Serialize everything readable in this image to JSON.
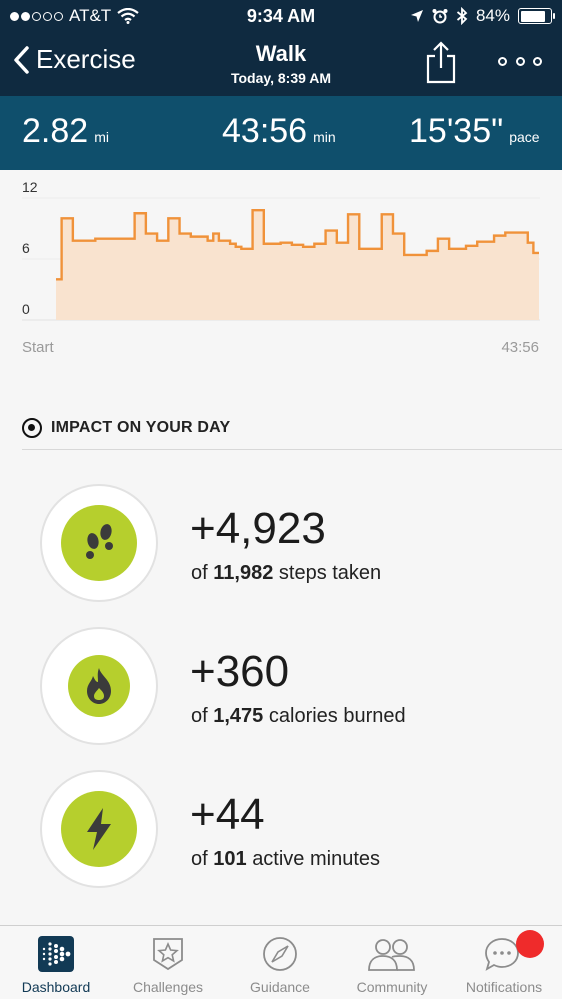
{
  "status_bar": {
    "carrier": "AT&T",
    "time": "9:34 AM",
    "battery": "84%",
    "battery_level": 0.84
  },
  "nav": {
    "back_label": "Exercise",
    "title": "Walk",
    "subtitle": "Today, 8:39 AM"
  },
  "stats": [
    {
      "value": "2.82",
      "unit": "mi"
    },
    {
      "value": "43:56",
      "unit": "min"
    },
    {
      "value": "15'35\"",
      "unit": "pace"
    }
  ],
  "chart_data": {
    "type": "area",
    "y_ticks": [
      "12",
      "6",
      "0"
    ],
    "ylim": [
      0,
      12
    ],
    "x_start_label": "Start",
    "x_end_label": "43:56",
    "grid": true,
    "color": "#f0923a",
    "fill": "#f9e3cf",
    "values": [
      4,
      10,
      10,
      7.8,
      7.8,
      7.8,
      7.8,
      8,
      8,
      8,
      8,
      8,
      8,
      8,
      10.5,
      10.5,
      8.5,
      8.5,
      7.8,
      7.8,
      10,
      10,
      8.5,
      8.5,
      8.2,
      8.2,
      8.2,
      7.8,
      8.5,
      7.8,
      7.8,
      7.5,
      7.2,
      7,
      7,
      10.8,
      10.8,
      7.5,
      7.5,
      7.5,
      7.6,
      7.6,
      7.4,
      7.4,
      7.2,
      7.2,
      7.5,
      7.5,
      8.8,
      8.8,
      7.6,
      7.6,
      10.4,
      10.4,
      7,
      7,
      7,
      7,
      10.4,
      10.4,
      8.5,
      8.5,
      6.4,
      6.4,
      6.4,
      6.4,
      6.8,
      6.8,
      8,
      8,
      7,
      7,
      7,
      7.3,
      7.3,
      7.7,
      7.7,
      7.7,
      8.3,
      8.3,
      8.6,
      8.6,
      8.6,
      8.6,
      7.6,
      6.6
    ]
  },
  "impact": {
    "header": "IMPACT ON YOUR DAY",
    "metrics": [
      {
        "icon": "footsteps-icon",
        "value": "+4,923",
        "prefix": "of",
        "total": "11,982",
        "suffix": "steps taken"
      },
      {
        "icon": "flame-icon",
        "value": "+360",
        "prefix": "of",
        "total": "1,475",
        "suffix": "calories burned"
      },
      {
        "icon": "lightning-icon",
        "value": "+44",
        "prefix": "of",
        "total": "101",
        "suffix": "active minutes"
      }
    ]
  },
  "tabs": [
    {
      "label": "Dashboard",
      "icon": "dashboard-icon",
      "active": true
    },
    {
      "label": "Challenges",
      "icon": "star-badge-icon",
      "active": false
    },
    {
      "label": "Guidance",
      "icon": "compass-icon",
      "active": false
    },
    {
      "label": "Community",
      "icon": "community-icon",
      "active": false
    },
    {
      "label": "Notifications",
      "icon": "chat-bubble-icon",
      "active": false
    }
  ],
  "colors": {
    "header": "#0f2a40",
    "stats": "#0f4f6c",
    "accent_green": "#b6cf2d",
    "notification": "#ef2b2b"
  }
}
